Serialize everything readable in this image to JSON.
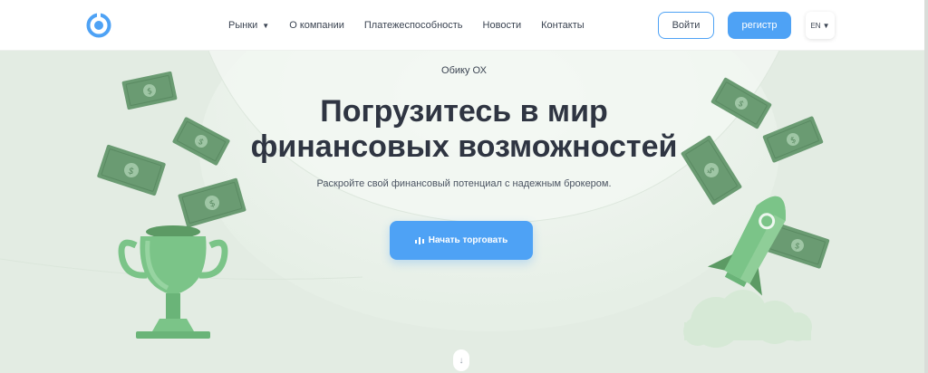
{
  "header": {
    "nav": [
      {
        "label": "Рынки",
        "has_dropdown": true
      },
      {
        "label": "О компании"
      },
      {
        "label": "Платежеспособность"
      },
      {
        "label": "Новости"
      },
      {
        "label": "Контакты"
      }
    ],
    "login_label": "Войти",
    "register_label": "регистр",
    "language": "EN"
  },
  "hero": {
    "brand": "Обику ОХ",
    "title_line1": "Погрузитесь в мир",
    "title_line2": "финансовых возможностей",
    "subtitle": "Раскройте свой финансовый потенциал с надежным брокером.",
    "cta_label": "Начать торговать"
  },
  "colors": {
    "accent": "#4ea2f5",
    "hero_bg": "#e3ece3",
    "title": "#2f3542",
    "money": "#6a9b72"
  },
  "icons": [
    "logo-icon",
    "chevron-down-icon",
    "signal-icon",
    "arrow-down-icon",
    "money-bill-icon",
    "trophy-icon",
    "rocket-icon"
  ]
}
